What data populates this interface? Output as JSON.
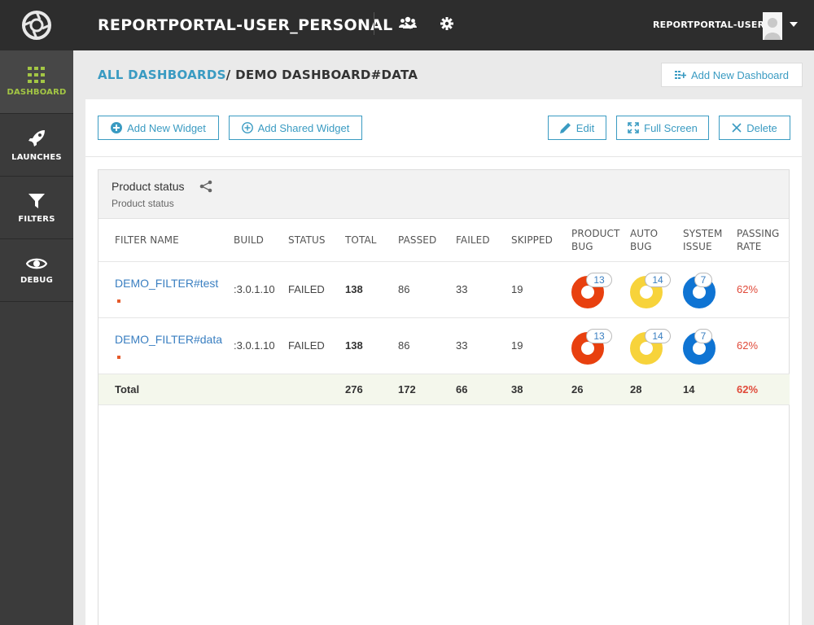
{
  "sidebar": {
    "items": [
      {
        "label": "DASHBOARD",
        "icon": "grid-icon",
        "active": true
      },
      {
        "label": "LAUNCHES",
        "icon": "rocket-icon"
      },
      {
        "label": "FILTERS",
        "icon": "funnel-icon"
      },
      {
        "label": "DEBUG",
        "icon": "eye-icon"
      }
    ]
  },
  "header": {
    "project": "REPORTPORTAL-USER_PERSONAL",
    "user": "REPORTPORTAL-USER"
  },
  "breadcrumb": {
    "root": "ALL DASHBOARDS",
    "separator": "/",
    "current": "DEMO DASHBOARD#DATA"
  },
  "add_dashboard_label": "Add New Dashboard",
  "toolbar": {
    "add_widget": "Add New Widget",
    "add_shared_widget": "Add Shared Widget",
    "edit": "Edit",
    "full_screen": "Full Screen",
    "delete": "Delete"
  },
  "widget": {
    "title": "Product status",
    "subtitle": "Product status",
    "columns": {
      "filter_name": "FILTER NAME",
      "build": "BUILD",
      "status": "STATUS",
      "total": "TOTAL",
      "passed": "PASSED",
      "failed": "FAILED",
      "skipped": "SKIPPED",
      "product_bug_1": "PRODUCT",
      "product_bug_2": "BUG",
      "auto_bug_1": "AUTO",
      "auto_bug_2": "BUG",
      "system_issue_1": "SYSTEM",
      "system_issue_2": "ISSUE",
      "passing_rate_1": "PASSING",
      "passing_rate_2": "RATE"
    },
    "rows": [
      {
        "filter": "DEMO_FILTER#test",
        "build": ":3.0.1.10",
        "status": "FAILED",
        "total": "138",
        "passed": "86",
        "failed": "33",
        "skipped": "19",
        "product_bug": "13",
        "auto_bug": "14",
        "system_issue": "7",
        "passing_rate": "62%"
      },
      {
        "filter": "DEMO_FILTER#data",
        "build": ":3.0.1.10",
        "status": "FAILED",
        "total": "138",
        "passed": "86",
        "failed": "33",
        "skipped": "19",
        "product_bug": "13",
        "auto_bug": "14",
        "system_issue": "7",
        "passing_rate": "62%"
      }
    ],
    "total_row": {
      "label": "Total",
      "total": "276",
      "passed": "172",
      "failed": "66",
      "skipped": "38",
      "product_bug": "26",
      "auto_bug": "28",
      "system_issue": "14",
      "passing_rate": "62%"
    }
  },
  "colors": {
    "product_bug": "#e8400f",
    "auto_bug": "#f7d33b",
    "system_issue": "#0f74d3",
    "accent": "#3a9bc2",
    "active_nav": "#a3c644"
  }
}
